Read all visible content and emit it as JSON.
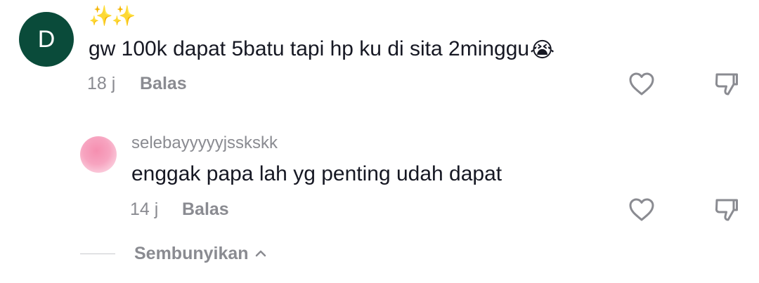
{
  "comment": {
    "avatar_letter": "D",
    "decoration": "✨✨",
    "text": "gw 100k dapat 5batu tapi hp ku di sita 2minggu",
    "emoji": "😭",
    "time": "18 j",
    "reply_label": "Balas",
    "like_icon": "heart-outline-icon",
    "dislike_icon": "thumbs-down-outline-icon"
  },
  "reply": {
    "username": "selebayyyyyjsskskk",
    "text": "enggak papa lah yg penting udah dapat",
    "time": "14 j",
    "reply_label": "Balas",
    "like_icon": "heart-outline-icon",
    "dislike_icon": "thumbs-down-outline-icon"
  },
  "thread": {
    "hide_label": "Sembunyikan",
    "hide_icon": "chevron-up-icon"
  },
  "colors": {
    "avatar_bg": "#0a4b3a",
    "text_primary": "#161823",
    "text_secondary": "#8a8b91",
    "icon_stroke": "#8a8b91"
  }
}
